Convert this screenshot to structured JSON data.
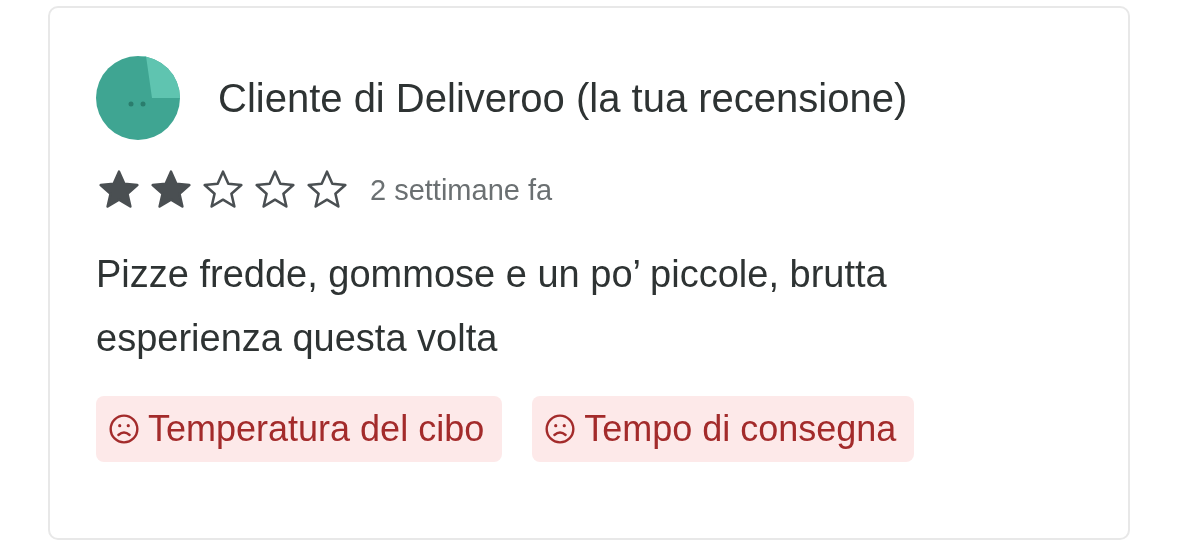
{
  "review": {
    "author": "Cliente di Deliveroo (la tua recensione)",
    "stars": 2,
    "time": "2 settimane fa",
    "text": "Pizze fredde, gommose e un po’ piccole, brutta esperienza questa volta",
    "tags": [
      {
        "label": "Temperatura del cibo"
      },
      {
        "label": "Tempo di consegna"
      }
    ]
  }
}
